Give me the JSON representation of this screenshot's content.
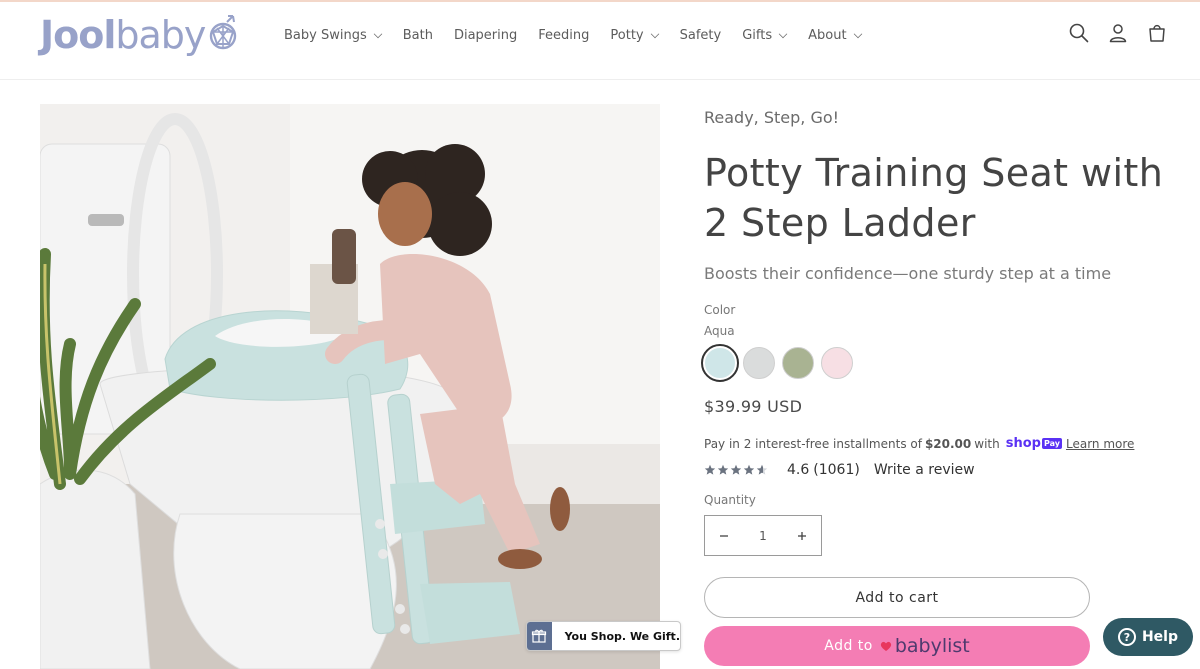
{
  "header": {
    "logo_bold": "Jool",
    "logo_light": "baby",
    "nav": [
      {
        "label": "Baby Swings",
        "dropdown": true
      },
      {
        "label": "Bath",
        "dropdown": false
      },
      {
        "label": "Diapering",
        "dropdown": false
      },
      {
        "label": "Feeding",
        "dropdown": false
      },
      {
        "label": "Potty",
        "dropdown": true
      },
      {
        "label": "Safety",
        "dropdown": false
      },
      {
        "label": "Gifts",
        "dropdown": true
      },
      {
        "label": "About",
        "dropdown": true
      }
    ],
    "icons": [
      "search-icon",
      "account-icon",
      "cart-icon"
    ]
  },
  "product": {
    "eyebrow": "Ready, Step, Go!",
    "title": "Potty Training Seat with 2 Step Ladder",
    "subtitle": "Boosts their confidence—one sturdy step at a time",
    "color_label": "Color",
    "color_value": "Aqua",
    "swatches": [
      {
        "name": "Aqua",
        "color": "#cfe6e8",
        "selected": true
      },
      {
        "name": "Gray",
        "color": "#dadcdc",
        "selected": false
      },
      {
        "name": "Sage",
        "color": "#a9b392",
        "selected": false
      },
      {
        "name": "Pink",
        "color": "#f7dfe4",
        "selected": false
      }
    ],
    "price": "$39.99 USD",
    "installments": {
      "prefix": "Pay in 2 interest-free installments of",
      "amount": "$20.00",
      "suffix": "with",
      "shop_word": "shop",
      "pay_word": "Pay",
      "learn_more": "Learn more"
    },
    "rating": {
      "value": "4.6",
      "count": "(1061)",
      "stars": 4.6,
      "write_review": "Write a review"
    },
    "quantity_label": "Quantity",
    "quantity": "1",
    "add_to_cart": "Add to cart",
    "babylist": {
      "prefix": "Add to",
      "brand": "babylist"
    }
  },
  "widgets": {
    "gift_text": "You Shop. We Gift.",
    "help": "Help"
  },
  "colors": {
    "brand": "#98a2c9",
    "babylist_pink": "#f47db4",
    "help_bg": "#2f5964",
    "shop_pay": "#5a31f4"
  }
}
